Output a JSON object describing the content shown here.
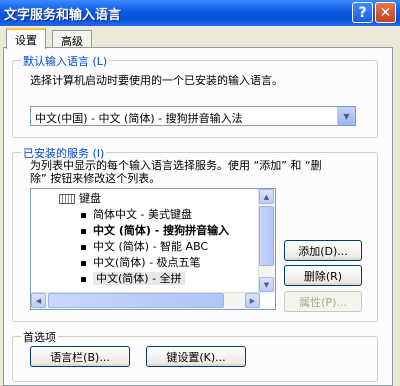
{
  "window": {
    "title": "文字服务和输入语言",
    "help_glyph": "?",
    "close_glyph": "✕"
  },
  "tabs": [
    {
      "label": "设置",
      "active": true
    },
    {
      "label": "高级",
      "active": false
    }
  ],
  "default_language": {
    "legend": "默认输入语言 (L)",
    "description": "选择计算机启动时要使用的一个已安装的输入语言。",
    "selected": "中文(中国) - 中文 (简体) - 搜狗拼音输入法"
  },
  "installed_services": {
    "legend": "已安装的服务 (I)",
    "description_line1": "为列表中显示的每个输入语言选择服务。使用 “添加” 和 “删",
    "description_line2": "除” 按钮来修改这个列表。",
    "tree": {
      "category": "键盘",
      "items": [
        {
          "label": "简体中文 - 美式键盘",
          "bold": false
        },
        {
          "label": "中文 (简体) - 搜狗拼音输入",
          "bold": true
        },
        {
          "label": "中文 (简体) - 智能 ABC",
          "bold": false
        },
        {
          "label": "中文(简体) - 极点五笔",
          "bold": false
        },
        {
          "label": "中文(简体) - 全拼",
          "bold": false
        }
      ]
    },
    "buttons": {
      "add": "添加(D)...",
      "remove": "删除(R)",
      "properties": "属性(P)..."
    }
  },
  "preferences": {
    "legend": "首选项",
    "language_bar": "语言栏(B)...",
    "key_settings": "键设置(K)..."
  },
  "colors": {
    "titlebar": "#0F5DE8",
    "legend_text": "#0046D5",
    "dialog_bg": "#ECE9D8"
  }
}
